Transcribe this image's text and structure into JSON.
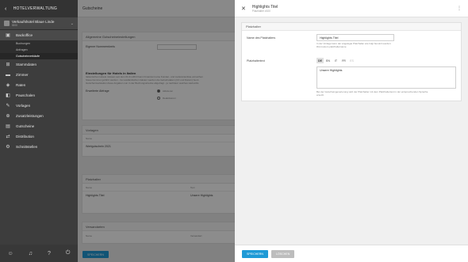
{
  "sidebar": {
    "title": "HOTELVERWALTUNG",
    "hotel": {
      "name": "Verkaufshotel Blaue Linde",
      "sub": "ID00"
    },
    "items": [
      {
        "label": "Backoffice",
        "icon": "briefcase-icon"
      },
      {
        "label": "Stammdaten",
        "icon": "database-icon"
      },
      {
        "label": "Zimmer",
        "icon": "bed-icon"
      },
      {
        "label": "Raten",
        "icon": "tag-icon"
      },
      {
        "label": "Pauschalen",
        "icon": "package-icon"
      },
      {
        "label": "Vorlagen",
        "icon": "template-icon"
      },
      {
        "label": "Zusatzleistungen",
        "icon": "plus-icon"
      },
      {
        "label": "Gutscheine",
        "icon": "gift-icon"
      },
      {
        "label": "Distribution",
        "icon": "share-icon"
      },
      {
        "label": "Schnittstellen",
        "icon": "plug-icon"
      }
    ],
    "sub_items": [
      {
        "label": "Buchungen"
      },
      {
        "label": "Anfragen"
      },
      {
        "label": "Gutscheinverkäufe"
      }
    ]
  },
  "main": {
    "header": "Gutscheine",
    "general": {
      "title": "Allgemeine Gutscheineinstellungen",
      "field_label": "Eigener Nummernkreis",
      "italy_title": "Einstellungen für Hotels in Italien",
      "italy_text1": "Italienischen Hotels müssen seit dem 01.01.2019 beim Finanzamt eine Kunden- und Lieferantenliste einreichen",
      "italy_text2": "Steuernummer geführt werden - bei ausländischen Gästen werden die Geburtsdaten (Ort und Datum) benö",
      "italy_text3": "Gutscheinverkäufen diese Angaben nun in der Buchungsstrecke abgefragt - je nachdem welches Herkunfts",
      "ext_label": "Erweiterte Abfrage",
      "opt_on": "Aktivieren",
      "opt_off": "Deaktivieren"
    },
    "templates": {
      "title": "Vorlagen",
      "col": "Name",
      "row": "Wertgutschein 2021"
    },
    "placeholders": {
      "title": "Platzhalter",
      "col1": "Name",
      "col2": "Text",
      "row_name": "Highlights Titel",
      "row_text": "Unsere Highlights"
    },
    "shipping": {
      "title": "Versandarten",
      "col1": "Name",
      "col2": "Versandart"
    },
    "save_label": "SPEICHERN"
  },
  "panel": {
    "title": "Highlights Titel",
    "subtitle": "Platzhalter #100",
    "card_title": "Platzhalter",
    "name_label": "Name des Platzhalters",
    "name_value": "Highlights Titel",
    "name_help1": "In der Vorlage kann der angelegte Platzhalter wie folgt benutzt werden:",
    "name_help2": "#txt:custom.platzhaltername",
    "text_label": "Platzhaltertext",
    "langs": [
      "DE",
      "EN",
      "IT",
      "FR",
      "ES"
    ],
    "text_value": "Unsere Highlights",
    "text_help1": "Bei der Gutscheingenerierung wird der Platzhalter mit dem Platzhaltertext in der entsprechenden Sprache",
    "text_help2": "ersetzt.",
    "save_label": "SPEICHERN",
    "delete_label": "LÖSCHEN"
  },
  "colors": {
    "accent": "#1f9ad6",
    "sidebar": "#3d3d3d"
  }
}
